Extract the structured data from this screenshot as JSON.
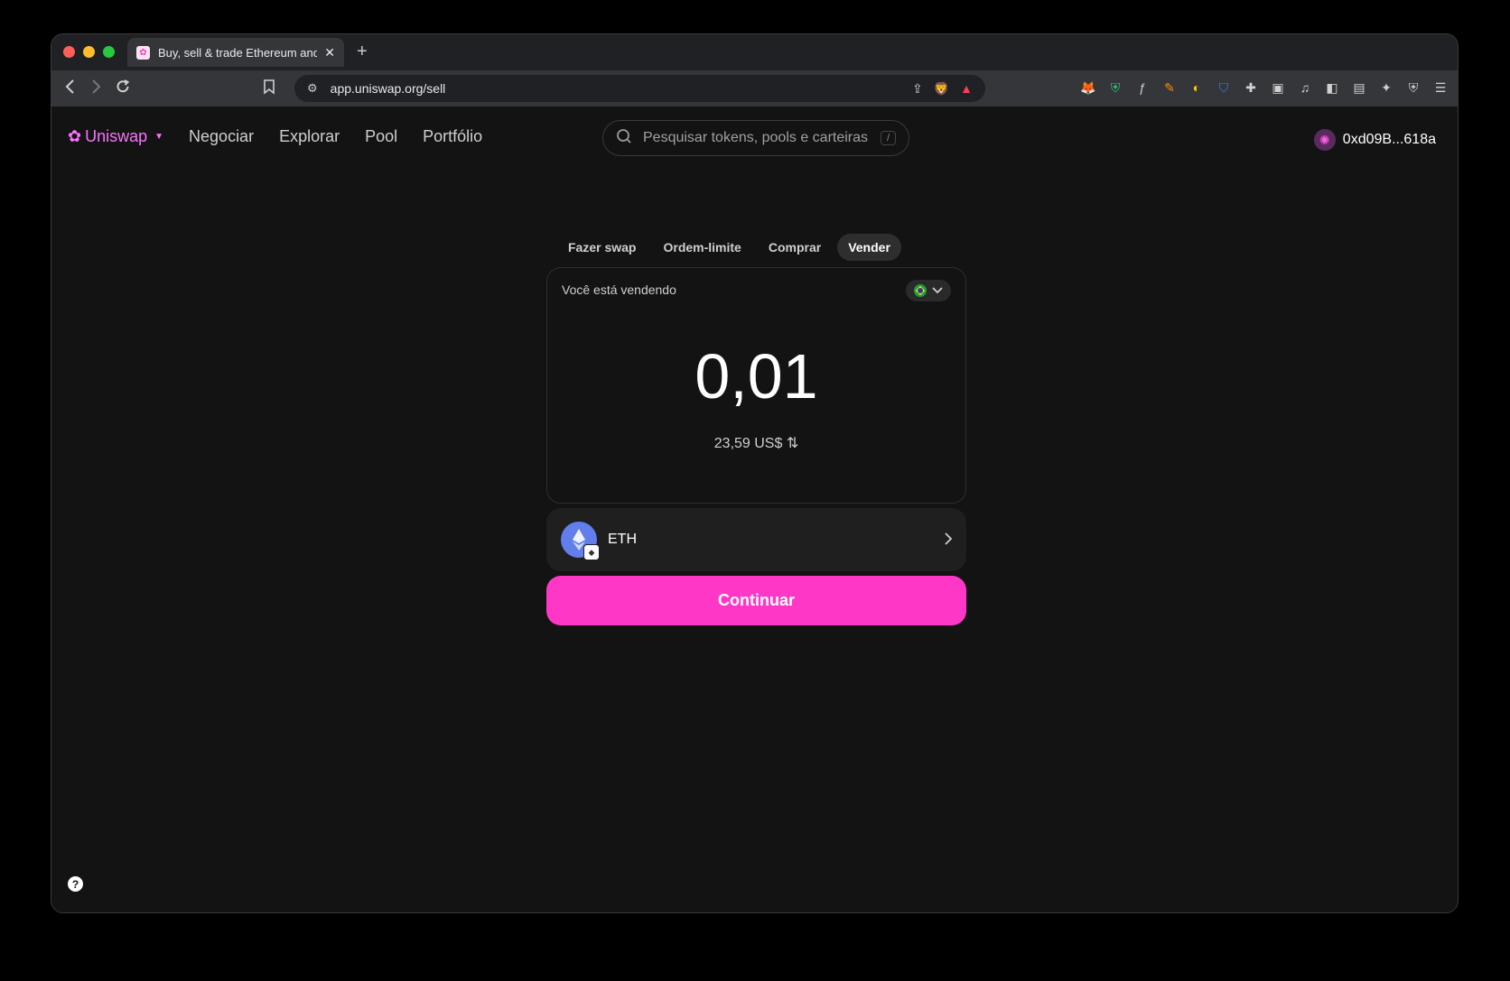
{
  "browser": {
    "tab_title": "Buy, sell & trade Ethereum and",
    "tab_close": "✕",
    "new_tab": "+",
    "url": "app.uniswap.org/sell"
  },
  "header": {
    "logo": "Uniswap",
    "nav": [
      "Negociar",
      "Explorar",
      "Pool",
      "Portfólio"
    ],
    "search_placeholder": "Pesquisar tokens, pools e carteiras",
    "search_shortcut": "/",
    "wallet": "0xd09B...618a"
  },
  "swap": {
    "tabs": [
      "Fazer swap",
      "Ordem-limite",
      "Comprar",
      "Vender"
    ],
    "active_tab": "Vender",
    "sell_label": "Você está vendendo",
    "amount": "0,01",
    "fiat_value": "23,59 US$",
    "token": "ETH",
    "continue_label": "Continuar"
  },
  "help": "?",
  "colors": {
    "accent": "#ff37c7",
    "logo": "#fc72ff",
    "background": "#131313",
    "eth": "#627eea"
  },
  "icons": {
    "tab_favicon": "uniswap-icon",
    "back": "back-arrow-icon",
    "forward": "forward-arrow-icon",
    "reload": "reload-icon",
    "bookmark": "bookmark-icon",
    "site_settings": "site-settings-icon",
    "share": "share-icon",
    "brave": "brave-shields-icon",
    "rewards": "brave-rewards-icon",
    "search": "search-icon",
    "country": "brazil-flag-icon",
    "swap_currency": "swap-arrows-icon",
    "chevron_right": "chevron-right-icon"
  }
}
